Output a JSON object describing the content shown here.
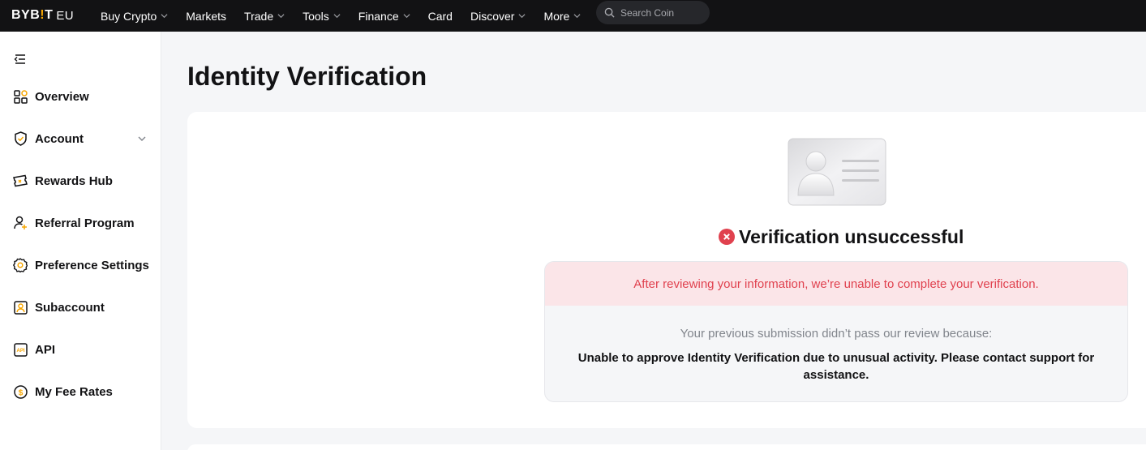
{
  "brand": {
    "logo_main": "BYB",
    "logo_bar": "!",
    "logo_tail": "T",
    "region": "EU"
  },
  "nav": {
    "items": [
      {
        "label": "Buy Crypto",
        "has_menu": true
      },
      {
        "label": "Markets",
        "has_menu": false
      },
      {
        "label": "Trade",
        "has_menu": true
      },
      {
        "label": "Tools",
        "has_menu": true
      },
      {
        "label": "Finance",
        "has_menu": true
      },
      {
        "label": "Card",
        "has_menu": false
      },
      {
        "label": "Discover",
        "has_menu": true
      },
      {
        "label": "More",
        "has_menu": true
      }
    ],
    "search_placeholder": "Search Coin"
  },
  "sidebar": {
    "items": [
      {
        "label": "Overview",
        "icon": "grid-icon"
      },
      {
        "label": "Account",
        "icon": "shield-check-icon",
        "expandable": true
      },
      {
        "label": "Rewards Hub",
        "icon": "ticket-icon"
      },
      {
        "label": "Referral Program",
        "icon": "user-plus-icon"
      },
      {
        "label": "Preference Settings",
        "icon": "gear-icon"
      },
      {
        "label": "Subaccount",
        "icon": "user-square-icon"
      },
      {
        "label": "API",
        "icon": "api-icon"
      },
      {
        "label": "My Fee Rates",
        "icon": "coin-icon"
      }
    ]
  },
  "page": {
    "title": "Identity Verification"
  },
  "verification": {
    "status": "Verification unsuccessful",
    "banner": "After reviewing your information, we’re unable to complete your verification.",
    "reason_intro": "Your previous submission didn’t pass our review because:",
    "reason": "Unable to approve Identity Verification due to unusual activity. Please contact support for assistance."
  },
  "colors": {
    "accent": "#f7a600",
    "error": "#e0414e",
    "error_bg": "#fbe5e8",
    "topbar": "#121214"
  }
}
